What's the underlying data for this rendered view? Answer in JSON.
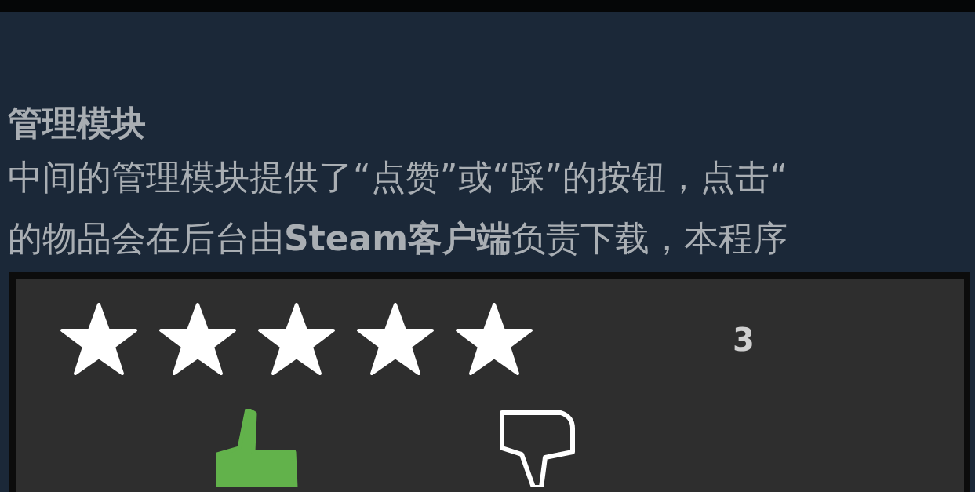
{
  "section": {
    "heading": "管理模块",
    "paragraph_lines": [
      "中间的管理模块提供了“点赞”或“踩”的按钮，点击“",
      "的物品会在后台由**Steam客户端**负责下载，本程序"
    ]
  },
  "screenshot": {
    "rating": {
      "stars": 5,
      "count": "3"
    },
    "thumbs_up": {
      "selected": true
    },
    "thumbs_down": {
      "selected": false
    }
  }
}
